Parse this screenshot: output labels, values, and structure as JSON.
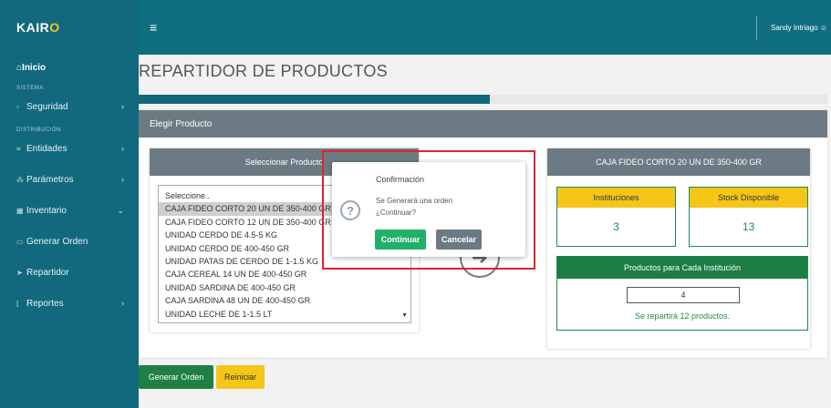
{
  "app": {
    "brand_main": "KAIR",
    "brand_accent": "O"
  },
  "topbar": {
    "menu_glyph": "≡",
    "user_name": "Sandy Intriago"
  },
  "sidebar": {
    "home_label": "Inicio",
    "section_sistema": "SISTEMA",
    "section_distribucion": "DISTRIBUCIÓN",
    "items": [
      {
        "label": "Seguridad",
        "icon": "lock-icon"
      },
      {
        "label": "Entidades",
        "icon": "list-icon"
      },
      {
        "label": "Parámetros",
        "icon": "sitemap-icon"
      },
      {
        "label": "Inventario",
        "icon": "table-icon"
      },
      {
        "label": "Generar Orden",
        "icon": "card-icon"
      },
      {
        "label": "Repartidor",
        "icon": "send-icon"
      },
      {
        "label": "Reportes",
        "icon": "chart-icon"
      }
    ]
  },
  "page": {
    "title": "REPARTIDOR DE PRODUCTOS",
    "progress_fraction": 0.51
  },
  "panel": {
    "title": "Elegir Producto"
  },
  "selector": {
    "title": "Seleccionar Producto",
    "options": [
      "Seleccione..",
      "CAJA FIDEO CORTO 20 UN DE 350-400 GR",
      "CAJA FIDEO CORTO 12 UN DE 350-400 GR",
      "UNIDAD CERDO DE 4.5-5 KG",
      "UNIDAD CERDO DE 400-450 GR",
      "UNIDAD PATAS DE CERDO DE 1-1.5 KG",
      "CAJA CEREAL 14 UN DE 400-450 GR",
      "UNIDAD SARDINA DE 400-450 GR",
      "CAJA SARDINA 48 UN DE 400-450 GR",
      "UNIDAD LECHE DE 1-1.5 LT"
    ],
    "selected_index": 1
  },
  "info": {
    "title": "CAJA FIDEO CORTO 20 UN DE 350-400 GR",
    "instituciones_label": "Instituciones",
    "instituciones_value": "3",
    "stock_label": "Stock Disponible",
    "stock_value": "13",
    "productos_label": "Productos para Cada Institución",
    "productos_value": "4",
    "repartira_text": "Se repartirá 12 productos."
  },
  "actions": {
    "generar_label": "Generar Orden",
    "reiniciar_label": "Reiniciar"
  },
  "dialog": {
    "title": "Confirmación",
    "message_line1": "Se Generará una orden",
    "message_line2": "¿Continuar?",
    "confirm_label": "Continuar",
    "cancel_label": "Cancelar"
  },
  "colors": {
    "sidebar": "#12697d",
    "panel_header": "#6c7b83",
    "green": "#1f7f45",
    "yellow": "#f5c518",
    "highlight": "#d9262c"
  }
}
